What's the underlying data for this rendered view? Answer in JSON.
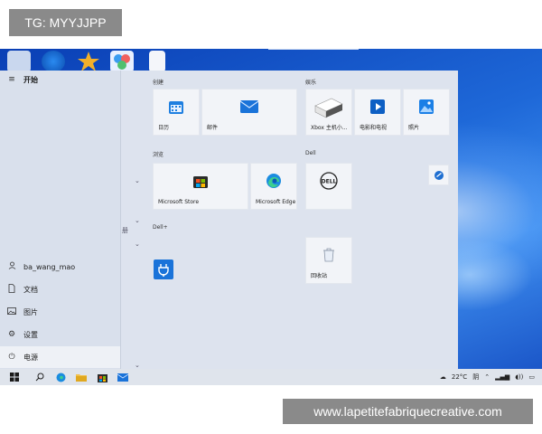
{
  "watermarks": {
    "top": "TG: MYYJJPP",
    "bottom": "www.lapetitefabriquecreative.com"
  },
  "start_menu": {
    "header": "开始",
    "user": "ba_wang_mao",
    "items": [
      {
        "label": "文档",
        "icon": "document-icon"
      },
      {
        "label": "图片",
        "icon": "pictures-icon"
      },
      {
        "label": "设置",
        "icon": "gear-icon"
      },
      {
        "label": "电源",
        "icon": "power-icon"
      }
    ],
    "side_hint": "册"
  },
  "groups": [
    {
      "title": "创建"
    },
    {
      "title": "娱乐"
    },
    {
      "title": "浏览"
    },
    {
      "title": "Dell"
    },
    {
      "title": "Dell+"
    }
  ],
  "tiles": {
    "calendar": "日历",
    "mail": "邮件",
    "xbox": "Xbox 主机小...",
    "movies": "电影和电视",
    "photos": "照片",
    "store": "Microsoft Store",
    "edge": "Microsoft Edge",
    "recycle": "回收站"
  },
  "taskbar": {
    "temperature": "22°C",
    "weather": "阴"
  },
  "colors": {
    "accent": "#1e68d8",
    "start_bg": "#dde3ee"
  }
}
